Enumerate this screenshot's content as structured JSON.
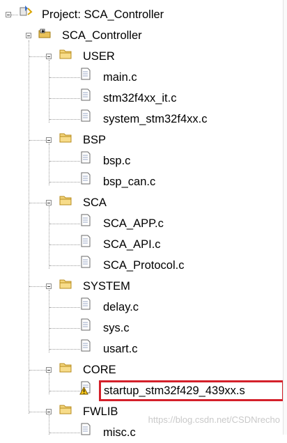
{
  "project": {
    "title": "Project: SCA_Controller",
    "root": "SCA_Controller"
  },
  "groups": [
    {
      "name": "USER",
      "files": [
        "main.c",
        "stm32f4xx_it.c",
        "system_stm32f4xx.c"
      ]
    },
    {
      "name": "BSP",
      "files": [
        "bsp.c",
        "bsp_can.c"
      ]
    },
    {
      "name": "SCA",
      "files": [
        "SCA_APP.c",
        "SCA_API.c",
        "SCA_Protocol.c"
      ]
    },
    {
      "name": "SYSTEM",
      "files": [
        "delay.c",
        "sys.c",
        "usart.c"
      ]
    },
    {
      "name": "CORE",
      "files": [
        "startup_stm32f429_439xx.s"
      ]
    },
    {
      "name": "FWLIB",
      "files": [
        "misc.c"
      ]
    }
  ],
  "selected_file": "startup_stm32f429_439xx.s",
  "highlight_color": "#d4202a",
  "watermark": "https://blog.csdn.net/CSDNrecho",
  "icons": {
    "project": "project-icon",
    "target": "target-icon",
    "folder": "folder-icon",
    "file": "c-file-icon",
    "warning": "warning-file-icon"
  }
}
